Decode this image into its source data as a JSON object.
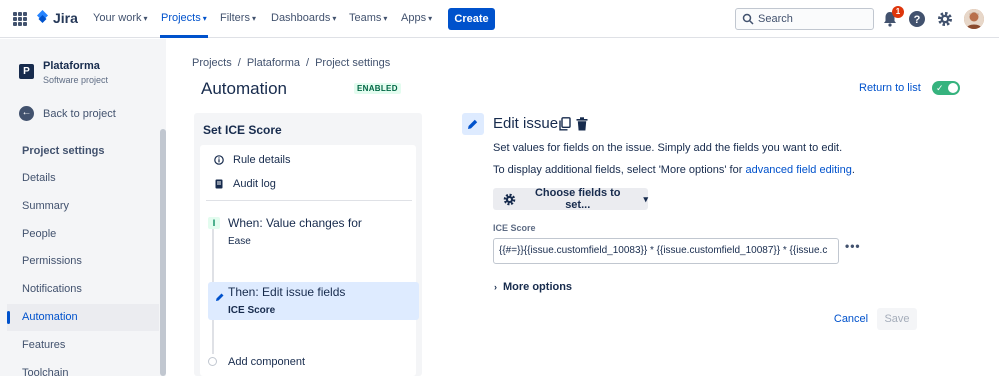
{
  "topnav": {
    "logo": "Jira",
    "items": [
      {
        "label": "Your work"
      },
      {
        "label": "Projects"
      },
      {
        "label": "Filters"
      },
      {
        "label": "Dashboards"
      },
      {
        "label": "Teams"
      },
      {
        "label": "Apps"
      }
    ],
    "create_label": "Create",
    "search_placeholder": "Search",
    "notification_count": "1",
    "icons": [
      "app-switcher-icon",
      "bell-icon",
      "help-icon",
      "settings-icon"
    ],
    "accent": "#0052CC"
  },
  "sidebar": {
    "project_name": "Plataforma",
    "project_type": "Software project",
    "project_initial": "P",
    "back_label": "Back to project",
    "heading": "Project settings",
    "items": [
      {
        "label": "Details"
      },
      {
        "label": "Summary"
      },
      {
        "label": "People"
      },
      {
        "label": "Permissions"
      },
      {
        "label": "Notifications"
      },
      {
        "label": "Automation",
        "active": true
      },
      {
        "label": "Features"
      },
      {
        "label": "Toolchain"
      }
    ]
  },
  "header": {
    "breadcrumb": [
      "Projects",
      "Plataforma",
      "Project settings"
    ],
    "title": "Automation",
    "status_badge": "ENABLED",
    "return_label": "Return to list",
    "toggle_on": true,
    "toggle_color": "#36B37E"
  },
  "rule": {
    "title": "Set ICE Score",
    "links": [
      "Rule details",
      "Audit log"
    ],
    "trigger_title": "When: Value changes for",
    "trigger_sub": "Ease",
    "action_title": "Then: Edit issue fields",
    "action_sub": "ICE Score",
    "add_component": "Add component"
  },
  "editor": {
    "title": "Edit issue",
    "desc1": "Set values for fields on the issue. Simply add the fields you want to edit.",
    "desc2_prefix": "To display additional fields, select 'More options' for ",
    "desc2_link": "advanced field editing",
    "desc2_suffix": ".",
    "choose_label": "Choose fields to set...",
    "field_label": "ICE Score",
    "field_value": "{{#=}}{{issue.customfield_10083}} * {{issue.customfield_10087}} * {{issue.c",
    "more_options": "More options",
    "cancel_label": "Cancel",
    "save_label": "Save"
  }
}
